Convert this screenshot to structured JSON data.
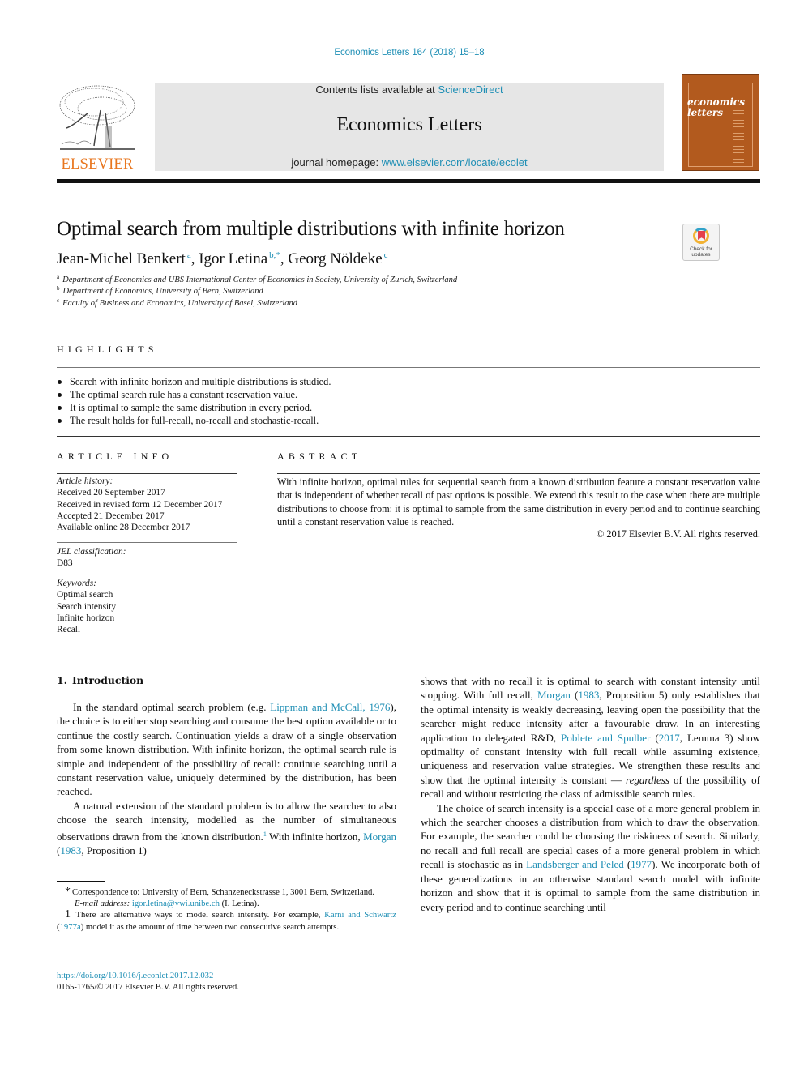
{
  "header": {
    "journal_ref": "Economics Letters 164 (2018) 15–18",
    "contents_prefix": "Contents lists available at ",
    "contents_link": "ScienceDirect",
    "journal_name": "Economics Letters",
    "homepage_prefix": "journal homepage: ",
    "homepage_link": "www.elsevier.com/locate/ecolet",
    "publisher": "ELSEVIER",
    "cover_title_line1": "economics",
    "cover_title_line2": "letters",
    "check_updates_line1": "Check for",
    "check_updates_line2": "updates"
  },
  "article": {
    "title": "Optimal search from multiple distributions with infinite horizon",
    "authors": [
      {
        "name": "Jean-Michel Benkert",
        "sup": "a",
        "sep": ", "
      },
      {
        "name": "Igor Letina",
        "sup": "b,*",
        "sep": ", "
      },
      {
        "name": "Georg Nöldeke",
        "sup": "c",
        "sep": ""
      }
    ],
    "affiliations": [
      {
        "key": "a",
        "text": "Department of Economics and UBS International Center of Economics in Society, University of Zurich, Switzerland"
      },
      {
        "key": "b",
        "text": "Department of Economics, University of Bern, Switzerland"
      },
      {
        "key": "c",
        "text": "Faculty of Business and Economics, University of Basel, Switzerland"
      }
    ]
  },
  "highlights": {
    "heading": "HIGHLIGHTS",
    "items": [
      "Search with infinite horizon and multiple distributions is studied.",
      "The optimal search rule has a constant reservation value.",
      "It is optimal to sample the same distribution in every period.",
      "The result holds for full-recall, no-recall and stochastic-recall."
    ]
  },
  "article_info": {
    "heading": "ARTICLE INFO",
    "history_label": "Article history:",
    "history": [
      "Received 20 September 2017",
      "Received in revised form 12 December 2017",
      "Accepted 21 December 2017",
      "Available online 28 December 2017"
    ],
    "jel_label": "JEL classification:",
    "jel": "D83",
    "keywords_label": "Keywords:",
    "keywords": [
      "Optimal search",
      "Search intensity",
      "Infinite horizon",
      "Recall"
    ]
  },
  "abstract": {
    "heading": "ABSTRACT",
    "text": "With infinite horizon, optimal rules for sequential search from a known distribution feature a constant reservation value that is independent of whether recall of past options is possible. We extend this result to the case when there are multiple distributions to choose from: it is optimal to sample from the same distribution in every period and to continue searching until a constant reservation value is reached.",
    "copyright": "© 2017 Elsevier B.V. All rights reserved."
  },
  "body": {
    "section_number": "1.",
    "section_title": "Introduction",
    "left": {
      "p1_a": "In the standard optimal search problem (e.g. ",
      "p1_link": "Lippman and McCall, 1976",
      "p1_b": "), the choice is to either stop searching and consume the best option available or to continue the costly search. Continuation yields a draw of a single observation from some known distribution. With infinite horizon, the optimal search rule is simple and independent of the possibility of recall: continue searching until a constant reservation value, uniquely determined by the distribution, has been reached.",
      "p2_a": "A natural extension of the standard problem is to allow the searcher to also choose the search intensity, modelled as the number of simultaneous observations drawn from the known distribution.",
      "p2_fn": "1",
      "p2_b": "  With infinite horizon, ",
      "p2_link1": "Morgan",
      "p2_c": " (",
      "p2_link2": "1983",
      "p2_d": ", Proposition 1)"
    },
    "right": {
      "p1_a": "shows that with no recall it is optimal to search with constant intensity until stopping. With full recall, ",
      "p1_link1": "Morgan",
      "p1_b": " (",
      "p1_link2": "1983",
      "p1_c": ", Proposition 5) only establishes that the optimal intensity is weakly decreasing, leaving open the possibility that the searcher might reduce intensity after a favourable draw. In an interesting application to delegated R&D, ",
      "p1_link3": "Poblete and Spulber",
      "p1_d": " (",
      "p1_link4": "2017",
      "p1_e": ", Lemma 3) show optimality of constant intensity with full recall while assuming existence, uniqueness and reservation value strategies. We strengthen these results and show that the optimal intensity is constant — ",
      "p1_em": "regardless",
      "p1_f": " of the possibility of recall and without restricting the class of admissible search rules.",
      "p2_a": "The choice of search intensity is a special case of a more general problem in which the searcher chooses a distribution from which to draw the observation. For example, the searcher could be choosing the riskiness of search. Similarly, no recall and full recall are special cases of a more general problem in which recall is stochastic as in ",
      "p2_link1": "Landsberger and Peled",
      "p2_b": " (",
      "p2_link2": "1977",
      "p2_c": "). We incorporate both of these generalizations in an otherwise standard search model with infinite horizon and show that it is optimal to sample from the same distribution in every period and to continue searching until"
    }
  },
  "footnotes": {
    "star_mark": "*",
    "correspondence": "Correspondence to: University of Bern, Schanzeneckstrasse 1, 3001 Bern, Switzerland.",
    "email_label": "E-mail address: ",
    "email": "igor.letina@vwi.unibe.ch",
    "email_suffix": " (I. Letina).",
    "fn1_mark": "1",
    "fn1_a": " There are alternative ways to model search intensity. For example, ",
    "fn1_link1": "Karni and Schwartz",
    "fn1_b": " (",
    "fn1_link2": "1977a",
    "fn1_c": ") model it as the amount of time between two consecutive search attempts."
  },
  "doi": {
    "url": "https://doi.org/10.1016/j.econlet.2017.12.032",
    "issn_line": "0165-1765/© 2017 Elsevier B.V. All rights reserved."
  }
}
